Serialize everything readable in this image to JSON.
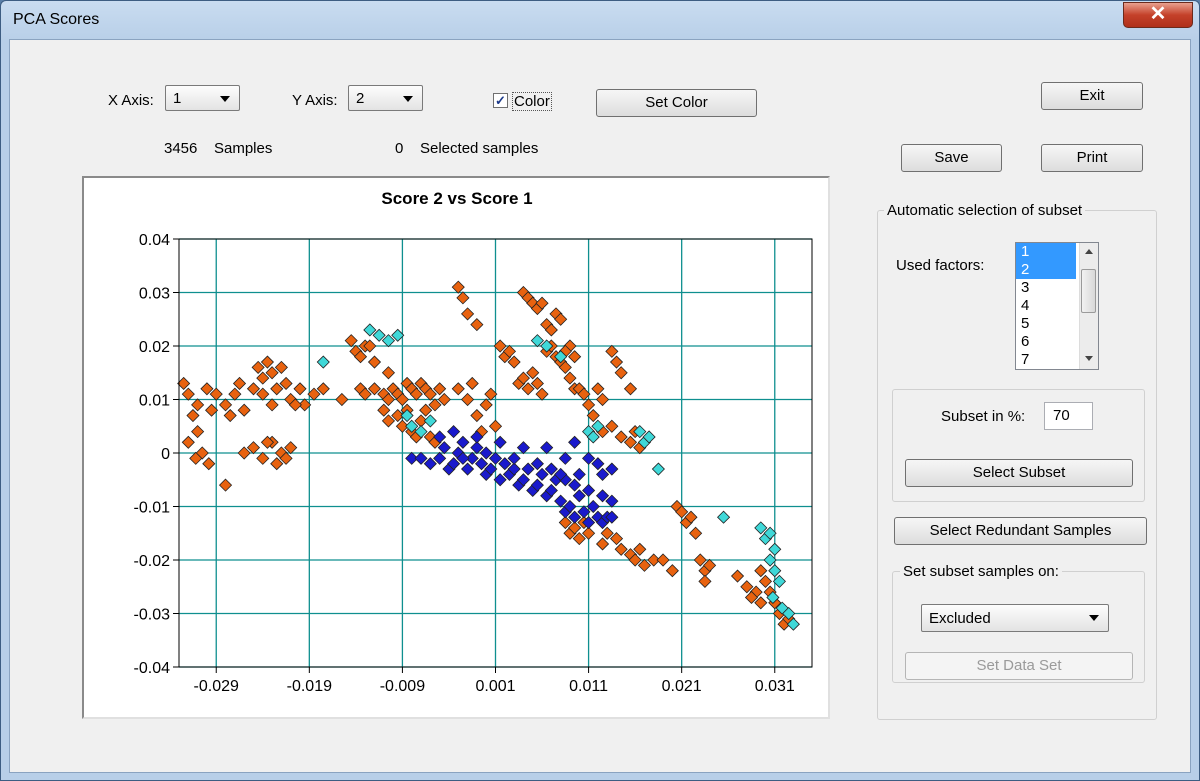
{
  "window": {
    "title": "PCA Scores",
    "close_glyph": "✕"
  },
  "controls": {
    "x_axis_label": "X Axis:",
    "x_axis_value": "1",
    "y_axis_label": "Y Axis:",
    "y_axis_value": "2",
    "color_label": "Color",
    "color_checked": true,
    "set_color_label": "Set Color",
    "exit_label": "Exit",
    "save_label": "Save",
    "print_label": "Print"
  },
  "stats": {
    "samples_count": "3456",
    "samples_label": "Samples",
    "selected_count": "0",
    "selected_label": "Selected samples"
  },
  "subset": {
    "group_title": "Automatic selection of subset",
    "used_factors_label": "Used factors:",
    "factors": [
      "1",
      "2",
      "3",
      "4",
      "5",
      "6",
      "7"
    ],
    "selected_factors": [
      "1",
      "2"
    ],
    "subset_percent_label": "Subset in %:",
    "subset_percent_value": "70",
    "select_subset_label": "Select Subset",
    "select_redundant_label": "Select Redundant Samples",
    "set_on_title": "Set subset samples on:",
    "set_on_value": "Excluded",
    "set_data_set_label": "Set Data Set"
  },
  "colors": {
    "orange": "#e8620f",
    "cyan": "#3fd8d8",
    "blue": "#1a1acc",
    "grid": "#0f8f8f"
  },
  "chart_data": {
    "type": "scatter",
    "title": "Score 2 vs Score 1",
    "xlim": [
      -0.033,
      0.035
    ],
    "ylim": [
      -0.04,
      0.04
    ],
    "xticks": [
      "-0.029",
      "-0.019",
      "-0.009",
      "0.001",
      "0.011",
      "0.021",
      "0.031"
    ],
    "xtick_values": [
      -0.029,
      -0.019,
      -0.009,
      0.001,
      0.011,
      0.021,
      0.031
    ],
    "yticks": [
      "0.04",
      "0.03",
      "0.02",
      "0.01",
      "0",
      "-0.01",
      "-0.02",
      "-0.03",
      "-0.04"
    ],
    "ytick_values": [
      0.04,
      0.03,
      0.02,
      0.01,
      0,
      -0.01,
      -0.02,
      -0.03,
      -0.04
    ],
    "grid": true,
    "series": [
      {
        "color": "#e8620f",
        "points": [
          [
            -0.0325,
            0.013
          ],
          [
            -0.032,
            0.011
          ],
          [
            -0.031,
            0.009
          ],
          [
            -0.0315,
            0.007
          ],
          [
            -0.03,
            0.012
          ],
          [
            -0.0295,
            0.008
          ],
          [
            -0.031,
            0.004
          ],
          [
            -0.032,
            0.002
          ],
          [
            -0.0305,
            0.0
          ],
          [
            -0.0298,
            -0.002
          ],
          [
            -0.0312,
            -0.001
          ],
          [
            -0.029,
            0.011
          ],
          [
            -0.028,
            0.009
          ],
          [
            -0.0275,
            0.007
          ],
          [
            -0.027,
            0.011
          ],
          [
            -0.0265,
            0.013
          ],
          [
            -0.028,
            -0.006
          ],
          [
            -0.026,
            0.008
          ],
          [
            -0.025,
            0.012
          ],
          [
            -0.0245,
            0.016
          ],
          [
            -0.024,
            0.014
          ],
          [
            -0.0235,
            0.017
          ],
          [
            -0.023,
            0.015
          ],
          [
            -0.0225,
            0.012
          ],
          [
            -0.022,
            0.016
          ],
          [
            -0.0215,
            0.013
          ],
          [
            -0.021,
            0.01
          ],
          [
            -0.02,
            0.012
          ],
          [
            -0.0195,
            0.009
          ],
          [
            -0.024,
            0.011
          ],
          [
            -0.023,
            0.009
          ],
          [
            -0.025,
            0.001
          ],
          [
            -0.024,
            -0.001
          ],
          [
            -0.023,
            0.002
          ],
          [
            -0.022,
            0.0
          ],
          [
            -0.0215,
            -0.001
          ],
          [
            -0.026,
            0.0
          ],
          [
            -0.0235,
            0.002
          ],
          [
            -0.0225,
            -0.002
          ],
          [
            -0.021,
            0.001
          ],
          [
            -0.0205,
            0.009
          ],
          [
            -0.0185,
            0.011
          ],
          [
            -0.0175,
            0.012
          ],
          [
            -0.0155,
            0.01
          ],
          [
            -0.0145,
            0.021
          ],
          [
            -0.014,
            0.019
          ],
          [
            -0.0135,
            0.018
          ],
          [
            -0.013,
            0.02
          ],
          [
            -0.0125,
            0.02
          ],
          [
            -0.012,
            0.017
          ],
          [
            -0.0105,
            0.015
          ],
          [
            -0.0135,
            0.012
          ],
          [
            -0.013,
            0.011
          ],
          [
            -0.012,
            0.012
          ],
          [
            -0.011,
            0.011
          ],
          [
            -0.0105,
            0.01
          ],
          [
            -0.01,
            0.012
          ],
          [
            -0.0095,
            0.011
          ],
          [
            -0.009,
            0.01
          ],
          [
            -0.0085,
            0.013
          ],
          [
            -0.008,
            0.012
          ],
          [
            -0.0075,
            0.011
          ],
          [
            -0.007,
            0.013
          ],
          [
            -0.0065,
            0.012
          ],
          [
            -0.006,
            0.011
          ],
          [
            -0.0055,
            0.009
          ],
          [
            -0.005,
            0.012
          ],
          [
            -0.0045,
            0.01
          ],
          [
            -0.011,
            0.008
          ],
          [
            -0.0105,
            0.006
          ],
          [
            -0.0095,
            0.007
          ],
          [
            -0.009,
            0.005
          ],
          [
            -0.0085,
            0.008
          ],
          [
            -0.008,
            0.004
          ],
          [
            -0.0075,
            0.003
          ],
          [
            -0.007,
            0.006
          ],
          [
            -0.0065,
            0.008
          ],
          [
            -0.006,
            0.003
          ],
          [
            -0.0055,
            0.002
          ],
          [
            -0.003,
            0.031
          ],
          [
            -0.0025,
            0.029
          ],
          [
            -0.002,
            0.026
          ],
          [
            -0.001,
            0.024
          ],
          [
            -0.0015,
            0.013
          ],
          [
            -0.003,
            0.012
          ],
          [
            -0.002,
            0.01
          ],
          [
            -0.001,
            0.007
          ],
          [
            0.0,
            0.009
          ],
          [
            0.0005,
            0.011
          ],
          [
            0.001,
            0.005
          ],
          [
            -0.0005,
            0.004
          ],
          [
            0.0015,
            0.02
          ],
          [
            0.002,
            0.018
          ],
          [
            0.0025,
            0.019
          ],
          [
            0.003,
            0.017
          ],
          [
            0.0035,
            0.013
          ],
          [
            0.004,
            0.014
          ],
          [
            0.0045,
            0.012
          ],
          [
            0.005,
            0.015
          ],
          [
            0.004,
            0.03
          ],
          [
            0.0045,
            0.029
          ],
          [
            0.005,
            0.028
          ],
          [
            0.0055,
            0.027
          ],
          [
            0.006,
            0.028
          ],
          [
            0.0065,
            0.024
          ],
          [
            0.007,
            0.023
          ],
          [
            0.0075,
            0.026
          ],
          [
            0.008,
            0.025
          ],
          [
            0.0065,
            0.019
          ],
          [
            0.007,
            0.02
          ],
          [
            0.0075,
            0.018
          ],
          [
            0.008,
            0.017
          ],
          [
            0.0085,
            0.016
          ],
          [
            0.009,
            0.014
          ],
          [
            0.0095,
            0.012
          ],
          [
            0.006,
            0.011
          ],
          [
            0.0055,
            0.013
          ],
          [
            0.009,
            0.02
          ],
          [
            0.0085,
            0.019
          ],
          [
            0.0095,
            0.018
          ],
          [
            0.01,
            0.012
          ],
          [
            0.0105,
            0.011
          ],
          [
            0.011,
            0.009
          ],
          [
            0.0115,
            0.007
          ],
          [
            0.012,
            0.012
          ],
          [
            0.0125,
            0.01
          ],
          [
            0.0135,
            0.019
          ],
          [
            0.014,
            0.017
          ],
          [
            0.0145,
            0.015
          ],
          [
            0.0155,
            0.012
          ],
          [
            0.0125,
            0.004
          ],
          [
            0.0135,
            0.005
          ],
          [
            0.0145,
            0.003
          ],
          [
            0.0155,
            0.002
          ],
          [
            0.016,
            0.004
          ],
          [
            0.0165,
            0.001
          ],
          [
            0.0085,
            -0.013
          ],
          [
            0.009,
            -0.015
          ],
          [
            0.0095,
            -0.014
          ],
          [
            0.01,
            -0.016
          ],
          [
            0.0105,
            -0.013
          ],
          [
            0.011,
            -0.015
          ],
          [
            0.0125,
            -0.017
          ],
          [
            0.013,
            -0.015
          ],
          [
            0.014,
            -0.016
          ],
          [
            0.0145,
            -0.018
          ],
          [
            0.0155,
            -0.019
          ],
          [
            0.016,
            -0.02
          ],
          [
            0.0165,
            -0.018
          ],
          [
            0.017,
            -0.021
          ],
          [
            0.018,
            -0.02
          ],
          [
            0.019,
            -0.02
          ],
          [
            0.02,
            -0.022
          ],
          [
            0.0205,
            -0.01
          ],
          [
            0.021,
            -0.011
          ],
          [
            0.0215,
            -0.013
          ],
          [
            0.022,
            -0.012
          ],
          [
            0.0225,
            -0.015
          ],
          [
            0.023,
            -0.02
          ],
          [
            0.0235,
            -0.022
          ],
          [
            0.024,
            -0.021
          ],
          [
            0.0235,
            -0.024
          ],
          [
            0.027,
            -0.023
          ],
          [
            0.028,
            -0.025
          ],
          [
            0.029,
            -0.026
          ],
          [
            0.0295,
            -0.022
          ],
          [
            0.03,
            -0.024
          ],
          [
            0.0285,
            -0.027
          ],
          [
            0.0295,
            -0.028
          ],
          [
            0.0305,
            -0.026
          ],
          [
            0.031,
            -0.028
          ],
          [
            0.0315,
            -0.03
          ],
          [
            0.032,
            -0.032
          ],
          [
            0.0325,
            -0.031
          ]
        ]
      },
      {
        "color": "#3fd8d8",
        "points": [
          [
            -0.0175,
            0.017
          ],
          [
            -0.0125,
            0.023
          ],
          [
            -0.0115,
            0.022
          ],
          [
            -0.0105,
            0.021
          ],
          [
            -0.0095,
            0.022
          ],
          [
            -0.0085,
            0.007
          ],
          [
            -0.008,
            0.005
          ],
          [
            -0.007,
            0.004
          ],
          [
            -0.006,
            0.006
          ],
          [
            0.0055,
            0.021
          ],
          [
            0.0065,
            0.02
          ],
          [
            0.008,
            0.018
          ],
          [
            0.011,
            0.004
          ],
          [
            0.0115,
            0.003
          ],
          [
            0.012,
            0.005
          ],
          [
            0.0165,
            0.004
          ],
          [
            0.017,
            0.002
          ],
          [
            0.0175,
            0.003
          ],
          [
            0.0185,
            -0.003
          ],
          [
            0.0255,
            -0.012
          ],
          [
            0.0295,
            -0.014
          ],
          [
            0.03,
            -0.016
          ],
          [
            0.0305,
            -0.015
          ],
          [
            0.031,
            -0.018
          ],
          [
            0.0305,
            -0.02
          ],
          [
            0.031,
            -0.022
          ],
          [
            0.0315,
            -0.024
          ],
          [
            0.0308,
            -0.027
          ],
          [
            0.0318,
            -0.029
          ],
          [
            0.0325,
            -0.03
          ],
          [
            0.033,
            -0.032
          ]
        ]
      },
      {
        "color": "#1a1acc",
        "points": [
          [
            -0.008,
            -0.001
          ],
          [
            -0.007,
            -0.001
          ],
          [
            -0.006,
            -0.002
          ],
          [
            -0.005,
            -0.001
          ],
          [
            -0.0045,
            0.001
          ],
          [
            -0.004,
            -0.003
          ],
          [
            -0.0035,
            -0.002
          ],
          [
            -0.003,
            0.0
          ],
          [
            -0.0025,
            0.002
          ],
          [
            -0.002,
            -0.003
          ],
          [
            -0.0015,
            -0.001
          ],
          [
            -0.001,
            0.001
          ],
          [
            -0.0005,
            -0.002
          ],
          [
            0.0,
            -0.004
          ],
          [
            0.0005,
            -0.003
          ],
          [
            0.001,
            -0.001
          ],
          [
            0.0015,
            -0.005
          ],
          [
            0.002,
            -0.002
          ],
          [
            0.0025,
            -0.004
          ],
          [
            0.003,
            -0.003
          ],
          [
            0.0035,
            -0.006
          ],
          [
            0.004,
            -0.005
          ],
          [
            0.0045,
            -0.003
          ],
          [
            0.005,
            -0.007
          ],
          [
            0.0055,
            -0.006
          ],
          [
            0.006,
            -0.004
          ],
          [
            0.0065,
            -0.008
          ],
          [
            0.007,
            -0.007
          ],
          [
            0.0075,
            -0.005
          ],
          [
            0.008,
            -0.009
          ],
          [
            0.0085,
            -0.011
          ],
          [
            0.009,
            -0.01
          ],
          [
            0.0095,
            -0.012
          ],
          [
            0.01,
            -0.008
          ],
          [
            0.0105,
            -0.011
          ],
          [
            0.011,
            -0.013
          ],
          [
            0.0115,
            -0.01
          ],
          [
            0.012,
            -0.012
          ],
          [
            0.0125,
            -0.013
          ],
          [
            0.013,
            -0.012
          ],
          [
            0.0135,
            -0.012
          ],
          [
            -0.005,
            0.003
          ],
          [
            -0.0035,
            0.004
          ],
          [
            -0.001,
            0.003
          ],
          [
            0.0015,
            0.002
          ],
          [
            0.004,
            0.001
          ],
          [
            0.0065,
            0.001
          ],
          [
            0.0085,
            -0.001
          ],
          [
            0.0095,
            0.002
          ],
          [
            0.011,
            -0.001
          ],
          [
            0.012,
            -0.002
          ],
          [
            0.0125,
            -0.004
          ],
          [
            0.0135,
            -0.003
          ],
          [
            0.01,
            -0.004
          ],
          [
            0.0085,
            -0.005
          ],
          [
            0.007,
            -0.003
          ],
          [
            0.0055,
            -0.002
          ],
          [
            0.003,
            -0.001
          ],
          [
            0.0,
            0.0
          ],
          [
            -0.0025,
            -0.001
          ],
          [
            0.011,
            -0.007
          ],
          [
            0.0125,
            -0.008
          ],
          [
            0.0135,
            -0.009
          ],
          [
            0.0095,
            -0.006
          ],
          [
            0.008,
            -0.004
          ]
        ]
      }
    ]
  }
}
